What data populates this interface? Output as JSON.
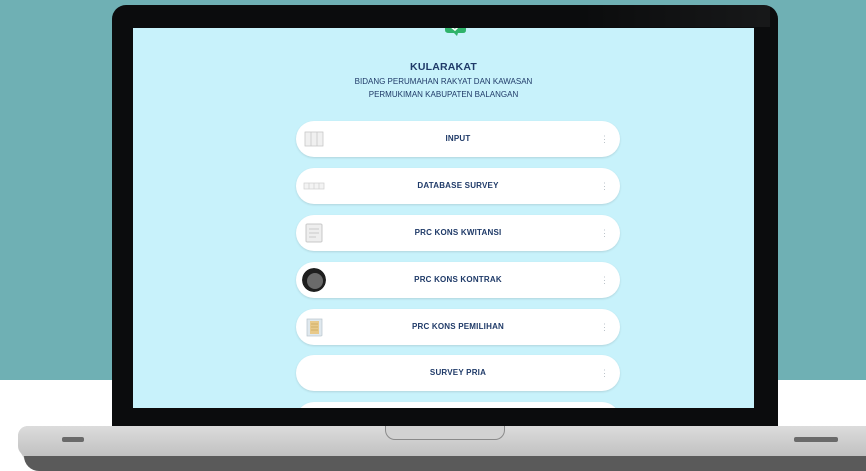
{
  "app": {
    "title": "KULARAKAT",
    "subtitle_line1": "BIDANG PERUMAHAN RAKYAT DAN KAWASAN",
    "subtitle_line2": "PERMUKIMAN KABUPATEN BALANGAN"
  },
  "menu": {
    "items": [
      {
        "label": "INPUT",
        "icon": "table-icon"
      },
      {
        "label": "DATABASE SURVEY",
        "icon": "table-icon"
      },
      {
        "label": "PRC KONS KWITANSI",
        "icon": "document-icon"
      },
      {
        "label": "PRC KONS KONTRAK",
        "icon": "dark-circle-icon"
      },
      {
        "label": "PRC KONS PEMILIHAN",
        "icon": "folder-icon"
      },
      {
        "label": "SURVEY PRIA",
        "icon": ""
      }
    ],
    "more_glyph": "⋮"
  },
  "colors": {
    "background": "#6fb0b4",
    "screen": "#c8f2fb",
    "text": "#1f3a68",
    "logo": "#2fb36a"
  }
}
